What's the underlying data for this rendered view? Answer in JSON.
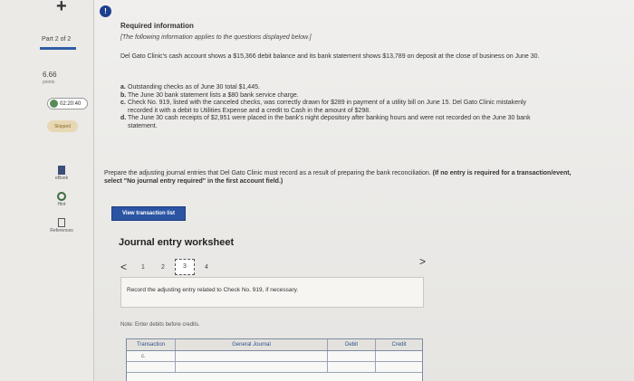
{
  "sidebar": {
    "part": "Part 2 of 2",
    "points_value": "6.66",
    "points_label": "points",
    "timer": "02:20:40",
    "skipped": "Skipped",
    "tools": [
      {
        "label": "eBook",
        "icon": "ebook-icon"
      },
      {
        "label": "Hint",
        "icon": "hint-icon"
      },
      {
        "label": "References",
        "icon": "references-icon"
      }
    ]
  },
  "info_badge": "!",
  "required": {
    "title": "Required information",
    "intro": "[The following information applies to the questions displayed below.]",
    "cash_text": "Del Gato Clinic's cash account shows a $15,366 debit balance and its bank statement shows $13,789 on deposit at the close of business on June 30.",
    "items": [
      {
        "letter": "a.",
        "text": "Outstanding checks as of June 30 total $1,445."
      },
      {
        "letter": "b.",
        "text": "The June 30 bank statement lists a $80 bank service charge."
      },
      {
        "letter": "c.",
        "text": "Check No. 919, listed with the canceled checks, was correctly drawn for $289 in payment of a utility bill on June 15. Del Gato Clinic mistakenly recorded it with a debit to Utilities Expense and a credit to Cash in the amount of $298."
      },
      {
        "letter": "d.",
        "text": "The June 30 cash receipts of $2,951 were placed in the bank's night depository after banking hours and were not recorded on the June 30 bank statement."
      }
    ]
  },
  "instructions": {
    "text": "Prepare the adjusting journal entries that Del Gato Clinic must record as a result of preparing the bank reconciliation. ",
    "bold": "(If no entry is required for a transaction/event, select \"No journal entry required\" in the first account field.)"
  },
  "view_button": "View transaction list",
  "worksheet": {
    "title": "Journal entry worksheet",
    "pages": [
      "1",
      "2",
      "3",
      "4"
    ],
    "active_page": "3",
    "prev": "<",
    "next": ">",
    "entry_prompt": "Record the adjusting entry related to Check No. 919, if necessary.",
    "note": "Note: Enter debits before credits.",
    "columns": [
      "Transaction",
      "General Journal",
      "Debit",
      "Credit"
    ],
    "rows": [
      {
        "transaction": "c."
      },
      {
        "transaction": ""
      }
    ]
  },
  "colors": {
    "accent": "#2b55a3",
    "badge": "#1e3f8f"
  }
}
